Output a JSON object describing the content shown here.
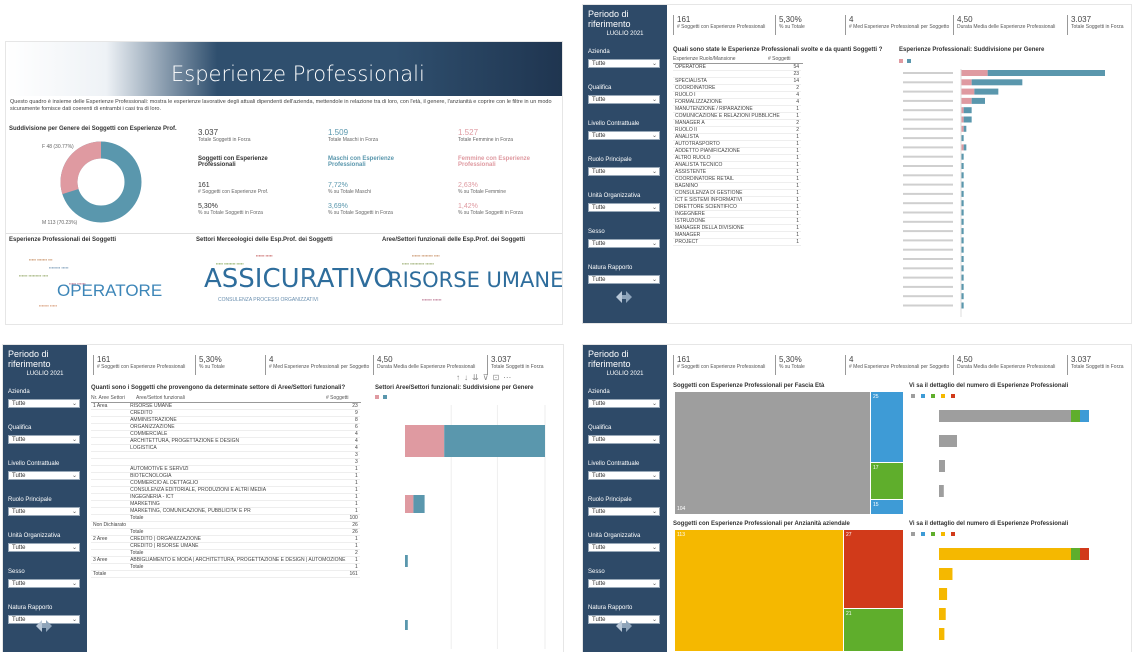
{
  "colors": {
    "sidebar": "#2e4a68",
    "teal": "#5a97ad",
    "pink": "#df9aa1",
    "gray": "#9e9e9e",
    "yellow": "#f5b800",
    "red": "#d13a1a",
    "green": "#5fae2c",
    "blue": "#3e9bd6"
  },
  "panel1": {
    "title": "Esperienze Professionali",
    "description": "Questo quadro è insieme delle Esperienze Professionali: mostra le esperienze lavorative degli attuali dipendenti dell'azienda, mettendole in relazione tra di loro, con l'età, il genere, l'anzianità e coprire con le filtre in un modo sicuramente fornisce dati coerenti di entrambi i casi tra di loro.",
    "donut_title": "Suddivisione per Genere dei Soggetti con Esperienze Prof.",
    "donut_label_f": "F 48 (30.77%)",
    "donut_label_m": "M 113 (70.23%)",
    "donut": {
      "F": 48,
      "M": 113
    },
    "kpis": [
      {
        "value": "3.037",
        "label": "Totale Soggetti in Forza"
      },
      {
        "value": "1.509",
        "label": "Totale Maschi in Forza"
      },
      {
        "value": "1.527",
        "label": "Totale Femmine in Forza"
      }
    ],
    "groups": [
      {
        "title": "Soggetti con Esperienze Professionali",
        "v1": "161",
        "l1": "# Soggetti con Esperienze Prof.",
        "v2": "5,30%",
        "l2": "% su Totale Soggetti in Forza"
      },
      {
        "title": "Maschi con Esperienze Professionali",
        "v1": "7,72%",
        "l1": "% su Totale Maschi",
        "v2": "3,69%",
        "l2": "% su Totale Soggetti in Forza"
      },
      {
        "title": "Femmine con Esperienze Professionali",
        "v1": "2,63%",
        "l1": "% su Totale Femmine",
        "v2": "1,42%",
        "l2": "% su Totale Soggetti in Forza"
      }
    ],
    "wc1_title": "Esperienze Professionali dei Soggetti",
    "wc1_word": "OPERATORE",
    "wc2_title": "Settori Merceologici delle Esp.Prof. dei Soggetti",
    "wc2_word": "ASSICURATIVO",
    "wc2_small": "CONSULENZA PROCESSI ORGANIZZATIVI",
    "wc3_title": "Aree/Settori funzionali delle Esp.Prof. dei Soggetti",
    "wc3_word": "RISORSE UMANE"
  },
  "sidebar": {
    "title": "Periodo di riferimento",
    "period": "LUGLIO 2021",
    "filters": [
      {
        "label": "Azienda",
        "value": "Tutte"
      },
      {
        "label": "Qualifica",
        "value": "Tutte"
      },
      {
        "label": "Livello Contrattuale",
        "value": "Tutte"
      },
      {
        "label": "Ruolo Principale",
        "value": "Tutte"
      },
      {
        "label": "Unità Organizzativa",
        "value": "Tutte"
      },
      {
        "label": "Sesso",
        "value": "Tutte"
      },
      {
        "label": "Natura Rapporto",
        "value": "Tutte"
      }
    ]
  },
  "kpibar": [
    {
      "value": "161",
      "label": "# Soggetti con Esperienze Professionali"
    },
    {
      "value": "5,30%",
      "label": "% su Totale"
    },
    {
      "value": "4",
      "label": "# Med Esperienze Professionali per Soggetto"
    },
    {
      "value": "4,50",
      "label": "Durata Media delle Esperienze Professionali"
    },
    {
      "value": "3.037",
      "label": "Totale Soggetti in Forza"
    }
  ],
  "panel2": {
    "table_title": "Quali sono state le Esperienze Professionali svolte e da quanti Soggetti ?",
    "chart_title": "Esperienze Professionali: Suddivisione per Genere",
    "col1": "Esperienze Ruolo/Mansione",
    "col2": "# Soggetti",
    "rows": [
      [
        "OPERATORE",
        "54"
      ],
      [
        "",
        "23"
      ],
      [
        "SPECIALISTA",
        "14"
      ],
      [
        "COORDINATORE",
        "2"
      ],
      [
        "RUOLO I",
        "4"
      ],
      [
        "FORMALIZZAZIONE",
        "4"
      ],
      [
        "MANUTENZIONE / RIPARAZIONE",
        "1"
      ],
      [
        "COMUNICAZIONE E RELAZIONI PUBBLICHE",
        "1"
      ],
      [
        "MANAGER A",
        "2"
      ],
      [
        "RUOLO II",
        "2"
      ],
      [
        "ANALISTA",
        "1"
      ],
      [
        "AUTOTRASPORTO",
        "1"
      ],
      [
        "ADDETTO PIANIFICAZIONE",
        "1"
      ],
      [
        "ALTRO RUOLO",
        "1"
      ],
      [
        "ANALISTA TECNICO",
        "1"
      ],
      [
        "ASSISTENTE",
        "1"
      ],
      [
        "COORDINATORE RETAIL",
        "1"
      ],
      [
        "BAGNINO",
        "1"
      ],
      [
        "CONSULENZA DI GESTIONE",
        "1"
      ],
      [
        "ICT E SISTEMI INFORMATIVI",
        "1"
      ],
      [
        "DIRETTORE SCIENTIFICO",
        "1"
      ],
      [
        "INGEGNERE",
        "1"
      ],
      [
        "ISTRUZIONE",
        "1"
      ],
      [
        "MANAGER DELLA DIVISIONE",
        "1"
      ],
      [
        "MANAGER",
        "1"
      ],
      [
        "PROJECT",
        "1"
      ]
    ],
    "bars": [
      {
        "f": 10,
        "m": 44
      },
      {
        "f": 4,
        "m": 19
      },
      {
        "f": 5,
        "m": 9
      },
      {
        "f": 4,
        "m": 5
      },
      {
        "f": 1,
        "m": 3
      },
      {
        "f": 1,
        "m": 3
      },
      {
        "f": 1,
        "m": 1
      },
      {
        "f": 0,
        "m": 1
      },
      {
        "f": 1,
        "m": 1
      },
      {
        "f": 0,
        "m": 1
      },
      {
        "f": 0,
        "m": 1
      },
      {
        "f": 0,
        "m": 1
      },
      {
        "f": 0,
        "m": 1
      },
      {
        "f": 0,
        "m": 1
      },
      {
        "f": 0,
        "m": 1
      },
      {
        "f": 0,
        "m": 1
      },
      {
        "f": 0,
        "m": 1
      },
      {
        "f": 0,
        "m": 1
      },
      {
        "f": 0,
        "m": 1
      },
      {
        "f": 0,
        "m": 1
      },
      {
        "f": 0,
        "m": 1
      },
      {
        "f": 0,
        "m": 1
      },
      {
        "f": 0,
        "m": 1
      },
      {
        "f": 0,
        "m": 1
      },
      {
        "f": 0,
        "m": 1
      },
      {
        "f": 0,
        "m": 1
      }
    ]
  },
  "panel3": {
    "table_title": "Quanti sono i Soggetti che provengono da determinate settore di Aree/Settori funzionali?",
    "chart_title": "Settori Aree/Settori funzionali: Suddivisione per Genere",
    "col1": "Nr. Aree Settori",
    "col2": "Aree/Settori funzionali",
    "col3": "# Soggetti",
    "groups": [
      {
        "group": "1 Area",
        "items": [
          "RISORSE UMANE",
          "CREDITO",
          "AMMINISTRAZIONE",
          "ORGANIZZAZIONE",
          "COMMERCIALE",
          "ARCHITETTURA, PROGETTAZIONE E DESIGN",
          "LOGISTICA",
          "",
          "",
          "AUTOMOTIVE E SERVIZI",
          "BIOTECNOLOGIA",
          "COMMERCIO AL DETTAGLIO",
          "CONSULENZA EDITORIALE, PRODUZIONI E ALTRI MEDIA",
          "INGEGNERIA - ICT",
          "MARKETING",
          "MARKETING, COMUNICAZIONE, PUBBLICITA' E PR",
          "Totale"
        ],
        "values": [
          "23",
          "9",
          "8",
          "6",
          "4",
          "4",
          "4",
          "3",
          "3",
          "1",
          "1",
          "1",
          "1",
          "1",
          "1",
          "1",
          "100"
        ]
      },
      {
        "group": "Non Dichiarato",
        "items": [
          "",
          "Totale"
        ],
        "values": [
          "26",
          "26"
        ]
      },
      {
        "group": "2 Aree",
        "items": [
          "CREDITO | ORGANIZZAZIONE",
          "CREDITO | RISORSE UMANE",
          "Totale"
        ],
        "values": [
          "1",
          "1",
          "2"
        ]
      },
      {
        "group": "3 Aree",
        "items": [
          "ABBIGLIAMENTO E MODA | ARCHITETTURA, PROGETTAZIONE E DESIGN | AUTOMOZIONE",
          "Totale"
        ],
        "values": [
          "1",
          "1"
        ]
      }
    ],
    "grand_total_label": "Totale",
    "grand_total": "161",
    "bars": [
      {
        "f": 14,
        "m": 36
      },
      {
        "f": 3,
        "m": 4
      },
      {
        "f": 0,
        "m": 1
      },
      {
        "f": 0,
        "m": 1
      }
    ]
  },
  "panel4": {
    "tl_title": "Soggetti con Esperienze Professionali per Fascia Età",
    "tr_title": "Vi sa il dettaglio del numero di Esperienze Professionali",
    "bl_title": "Soggetti con Esperienze Professionali per Anzianità aziendale",
    "br_title": "Vi sa il dettaglio del numero di Esperienze Professionali",
    "tree_top": [
      {
        "v": "104"
      },
      {
        "v": "25"
      },
      {
        "v": "17"
      },
      {
        "v": "15"
      }
    ],
    "tree_bottom": [
      {
        "v": "113"
      },
      {
        "v": "27"
      },
      {
        "v": "21"
      }
    ],
    "bars_top": [
      110,
      15,
      5,
      4
    ],
    "bars_bottom": [
      98,
      10,
      6,
      5,
      4
    ]
  }
}
